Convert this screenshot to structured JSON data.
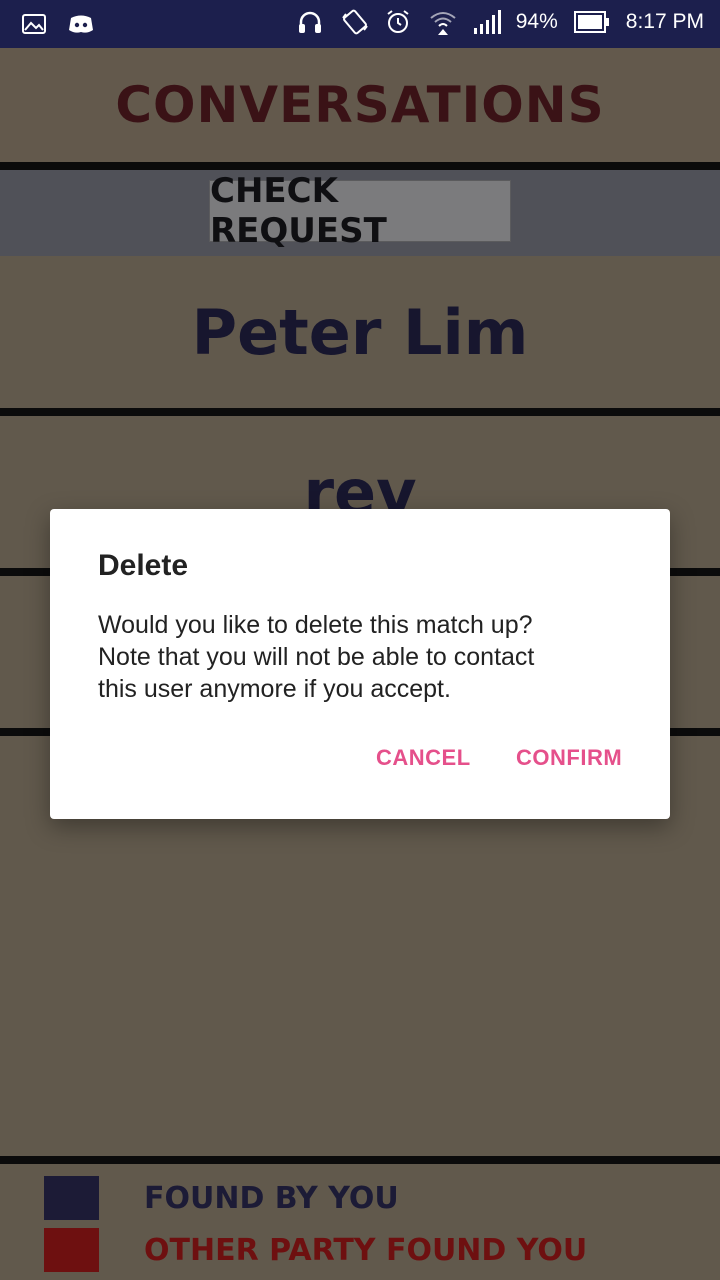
{
  "status_bar": {
    "battery": "94%",
    "time": "8:17 PM",
    "icons": [
      "gallery-icon",
      "discord-icon",
      "headphones-icon",
      "rotate-icon",
      "alarm-icon",
      "wifi-icon",
      "signal-icon",
      "battery-icon"
    ]
  },
  "header": {
    "title": "CONVERSATIONS"
  },
  "check_request": {
    "label": "CHECK REQUEST"
  },
  "conversations": [
    {
      "name": "Peter Lim"
    },
    {
      "name": "rev"
    }
  ],
  "legend": {
    "found_by_you": {
      "label": "FOUND BY YOU",
      "color": "#1c1b36"
    },
    "other_party": {
      "label": "OTHER PARTY FOUND YOU",
      "color": "#6e1010"
    }
  },
  "dialog": {
    "title": "Delete",
    "message_line1": "Would you like to delete this match up?",
    "message_line2": "Note that you will not be able to contact",
    "message_line3": "this user anymore if you accept.",
    "cancel_label": "CANCEL",
    "confirm_label": "CONFIRM",
    "accent_color": "#e5508b"
  }
}
